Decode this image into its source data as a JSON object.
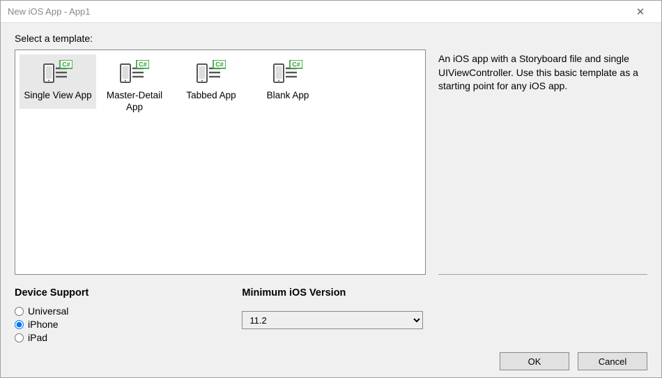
{
  "window": {
    "title": "New iOS App - App1",
    "close_glyph": "✕"
  },
  "prompt": "Select a template:",
  "templates": {
    "items": [
      {
        "label": "Single View App",
        "selected": true
      },
      {
        "label": "Master-Detail App",
        "selected": false
      },
      {
        "label": "Tabbed App",
        "selected": false
      },
      {
        "label": "Blank App",
        "selected": false
      }
    ]
  },
  "description": "An iOS app with a Storyboard file and single UIViewController. Use this basic template as a starting point for any iOS app.",
  "device_support": {
    "heading": "Device Support",
    "options": [
      {
        "label": "Universal",
        "checked": false
      },
      {
        "label": "iPhone",
        "checked": true
      },
      {
        "label": "iPad",
        "checked": false
      }
    ]
  },
  "min_ios": {
    "heading": "Minimum iOS Version",
    "selected": "11.2"
  },
  "buttons": {
    "ok": "OK",
    "cancel": "Cancel"
  }
}
